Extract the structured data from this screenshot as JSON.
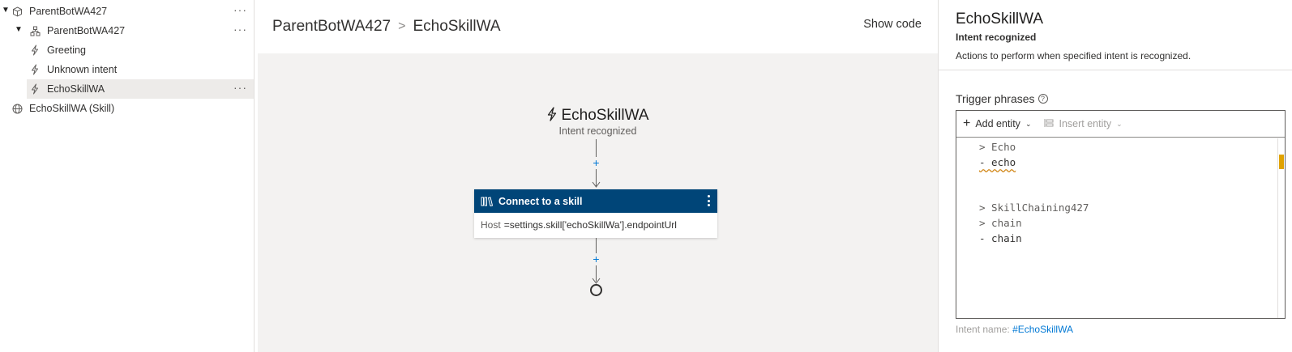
{
  "tree": {
    "root": {
      "label": "ParentBotWA427",
      "more": "···",
      "icon": "cube-icon"
    },
    "dialog": {
      "label": "ParentBotWA427",
      "more": "···",
      "icon": "dialog-tree-icon"
    },
    "triggers": [
      {
        "label": "Greeting",
        "icon": "lightning-icon"
      },
      {
        "label": "Unknown intent",
        "icon": "lightning-icon"
      },
      {
        "label": "EchoSkillWA",
        "icon": "lightning-icon",
        "selected": true,
        "more": "···"
      }
    ],
    "skill": {
      "label": "EchoSkillWA (Skill)",
      "icon": "globe-icon"
    }
  },
  "header": {
    "breadcrumb": [
      "ParentBotWA427",
      "EchoSkillWA"
    ],
    "separator": ">",
    "show_code": "Show code"
  },
  "flow": {
    "trigger_title": "EchoSkillWA",
    "trigger_subtitle": "Intent recognized",
    "add_symbol": "+",
    "card": {
      "title": "Connect to a skill",
      "host_label": "Host",
      "host_value": "=settings.skill['echoSkillWa'].endpointUrl"
    }
  },
  "props": {
    "title": "EchoSkillWA",
    "subtitle": "Intent recognized",
    "description": "Actions to perform when specified intent is recognized.",
    "trigger_phrases_label": "Trigger phrases",
    "help_glyph": "?",
    "toolbar": {
      "add_entity": "Add entity",
      "insert_entity": "Insert entity"
    },
    "editor_lines": [
      "> Echo",
      "- echo",
      "",
      "",
      "> SkillChaining427",
      "> chain",
      "- chain"
    ],
    "intent_name_label": "Intent name:",
    "intent_name_value": "#EchoSkillWA"
  },
  "colors": {
    "card_header": "#004578",
    "link": "#0078d4",
    "canvas_bg": "#f3f2f1",
    "warning_squiggle": "#d18616"
  }
}
